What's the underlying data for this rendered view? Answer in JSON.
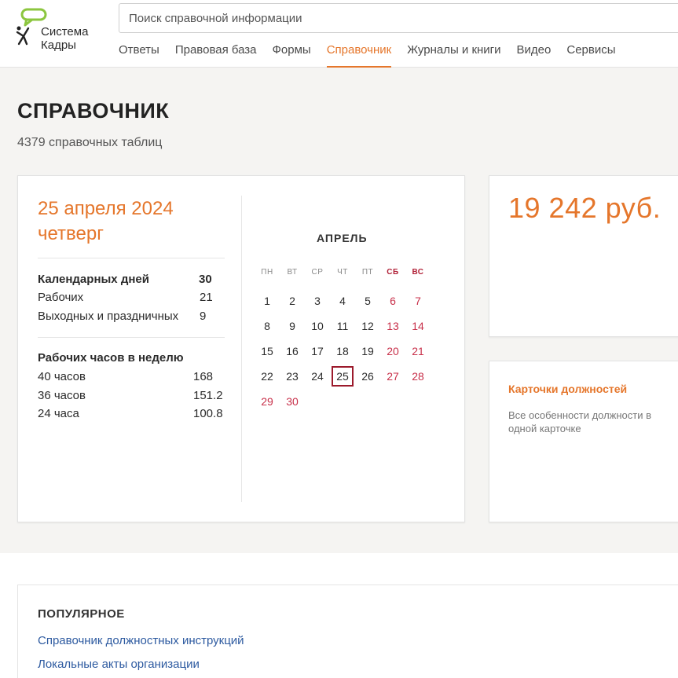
{
  "header": {
    "brand_line1": "Система",
    "brand_line2": "Кадры",
    "search_placeholder": "Поиск справочной информации",
    "nav": [
      {
        "label": "Ответы"
      },
      {
        "label": "Правовая база"
      },
      {
        "label": "Формы"
      },
      {
        "label": "Справочник",
        "active": true
      },
      {
        "label": "Журналы и книги"
      },
      {
        "label": "Видео"
      },
      {
        "label": "Сервисы"
      }
    ]
  },
  "page": {
    "title": "СПРАВОЧНИК",
    "subtitle": "4379 справочных таблиц"
  },
  "calendar_card": {
    "date_line1": "25 апреля 2024",
    "date_line2": "четверг",
    "days": [
      {
        "label": "Календарных дней",
        "value": "30",
        "bold": true
      },
      {
        "label": "Рабочих",
        "value": "21"
      },
      {
        "label": "Выходных и праздничных",
        "value": "9"
      }
    ],
    "hours_title": "Рабочих часов в неделю",
    "hours": [
      {
        "label": "40 часов",
        "value": "168"
      },
      {
        "label": "36 часов",
        "value": "151.2"
      },
      {
        "label": "24 часа",
        "value": "100.8"
      }
    ],
    "month": "АПРЕЛЬ",
    "weekdays": [
      "ПН",
      "ВТ",
      "СР",
      "ЧТ",
      "ПТ",
      "СБ",
      "ВС"
    ],
    "weeks": [
      [
        "1",
        "2",
        "3",
        "4",
        "5",
        "6",
        "7"
      ],
      [
        "8",
        "9",
        "10",
        "11",
        "12",
        "13",
        "14"
      ],
      [
        "15",
        "16",
        "17",
        "18",
        "19",
        "20",
        "21"
      ],
      [
        "22",
        "23",
        "24",
        "25",
        "26",
        "27",
        "28"
      ],
      [
        "29",
        "30",
        "",
        "",
        "",
        "",
        ""
      ]
    ],
    "weekend_extra": [
      "29",
      "30"
    ],
    "today": "25"
  },
  "price_card": {
    "value": "19 242 руб."
  },
  "job_card": {
    "title": "Карточки должностей",
    "description": "Все особенности должности в одной карточке"
  },
  "popular": {
    "title": "ПОПУЛЯРНОЕ",
    "links": [
      "Справочник должностных инструкций",
      "Локальные акты организации"
    ]
  },
  "colors": {
    "accent": "#e5762b",
    "weekend": "#c8304a",
    "today_border": "#9c1a2c",
    "link": "#2d5aa0",
    "logo_green": "#8cc63f"
  }
}
